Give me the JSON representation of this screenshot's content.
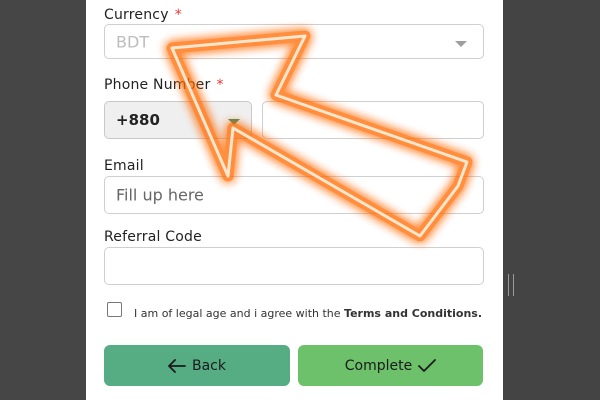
{
  "form": {
    "currency": {
      "label": "Currency",
      "required_mark": "*",
      "value": "BDT"
    },
    "phone": {
      "label": "Phone Number",
      "required_mark": "*",
      "country_code": "+880",
      "number_value": ""
    },
    "email": {
      "label": "Email",
      "placeholder": "Fill up here"
    },
    "referral": {
      "label": "Referral Code",
      "value": ""
    },
    "agreement": {
      "text": "I am of legal age and i agree with the ",
      "link": "Terms and Conditions.",
      "checked": false
    }
  },
  "buttons": {
    "back": {
      "label": "Back",
      "icon": "arrow-left-icon"
    },
    "complete": {
      "label": "Complete",
      "icon": "checkmark-icon"
    }
  },
  "colors": {
    "back_button": "#56ad84",
    "complete_button": "#6cc16a",
    "required": "#e53935",
    "arrow_glow": "#ff7a1a"
  }
}
